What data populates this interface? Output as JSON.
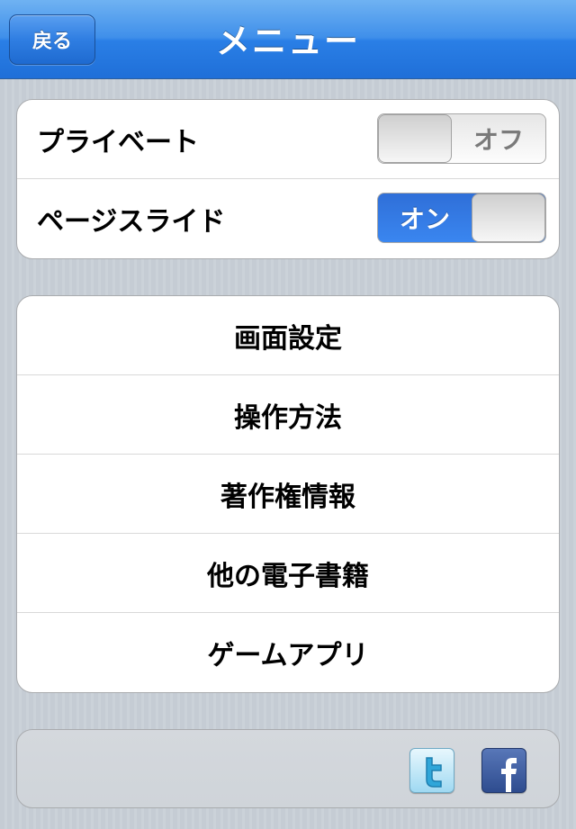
{
  "nav": {
    "title": "メニュー",
    "back_label": "戻る"
  },
  "toggles": [
    {
      "label": "プライベート",
      "state_text": "オフ",
      "on": false
    },
    {
      "label": "ページスライド",
      "state_text": "オン",
      "on": true
    }
  ],
  "menu": [
    {
      "label": "画面設定"
    },
    {
      "label": "操作方法"
    },
    {
      "label": "著作権情報"
    },
    {
      "label": "他の電子書籍"
    },
    {
      "label": "ゲームアプリ"
    }
  ],
  "footer": {
    "icons": [
      "twitter-icon",
      "facebook-icon"
    ]
  },
  "colors": {
    "nav_blue": "#2a7fe6",
    "toggle_on_blue": "#2f6fd8",
    "background": "#c5ccd4"
  }
}
